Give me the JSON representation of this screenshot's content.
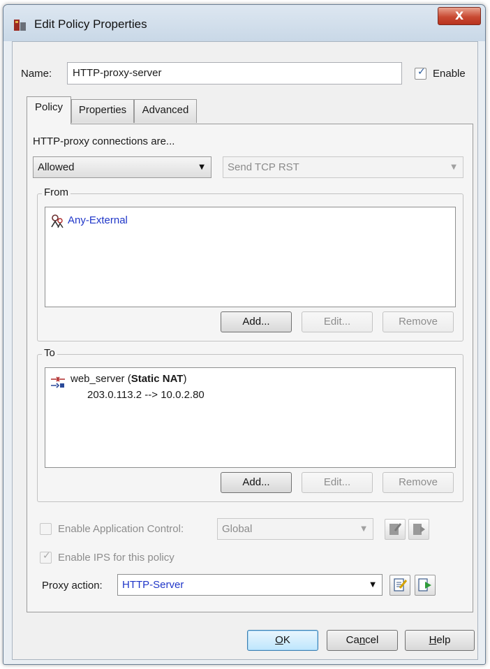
{
  "window": {
    "title": "Edit Policy Properties",
    "close_label": "X"
  },
  "name_row": {
    "label": "Name:",
    "value": "HTTP-proxy-server",
    "enable_label": "Enable",
    "enable_checked": true
  },
  "tabs": [
    {
      "label": "Policy"
    },
    {
      "label": "Properties"
    },
    {
      "label": "Advanced"
    }
  ],
  "policy": {
    "connections_label": "HTTP-proxy connections are...",
    "connections_value": "Allowed",
    "tcp_reset_value": "Send TCP RST",
    "from": {
      "title": "From",
      "items": [
        {
          "icon": "any-external-icon",
          "name": "Any-External"
        }
      ],
      "add_label": "Add...",
      "edit_label": "Edit...",
      "remove_label": "Remove"
    },
    "to": {
      "title": "To",
      "items": [
        {
          "icon": "static-nat-icon",
          "name": "web_server",
          "type_open": " (",
          "type": "Static NAT",
          "type_close": ")",
          "detail": "203.0.113.2 --> 10.0.2.80"
        }
      ],
      "add_label": "Add...",
      "edit_label": "Edit...",
      "remove_label": "Remove"
    },
    "app_control": {
      "label": "Enable Application Control:",
      "value": "Global",
      "checked": false
    },
    "ips": {
      "label": "Enable IPS for this policy",
      "checked": true
    }
  },
  "proxy_action": {
    "label": "Proxy action:",
    "value": "HTTP-Server"
  },
  "footer": {
    "ok": {
      "mnemonic": "O",
      "rest": "K"
    },
    "cancel": {
      "pre": "Ca",
      "mnemonic": "n",
      "rest": "cel"
    },
    "help": {
      "mnemonic": "H",
      "rest": "elp"
    }
  },
  "colors": {
    "link": "#1f36c8",
    "title_bar": "#c9d8e7",
    "close": "#c94a33"
  }
}
